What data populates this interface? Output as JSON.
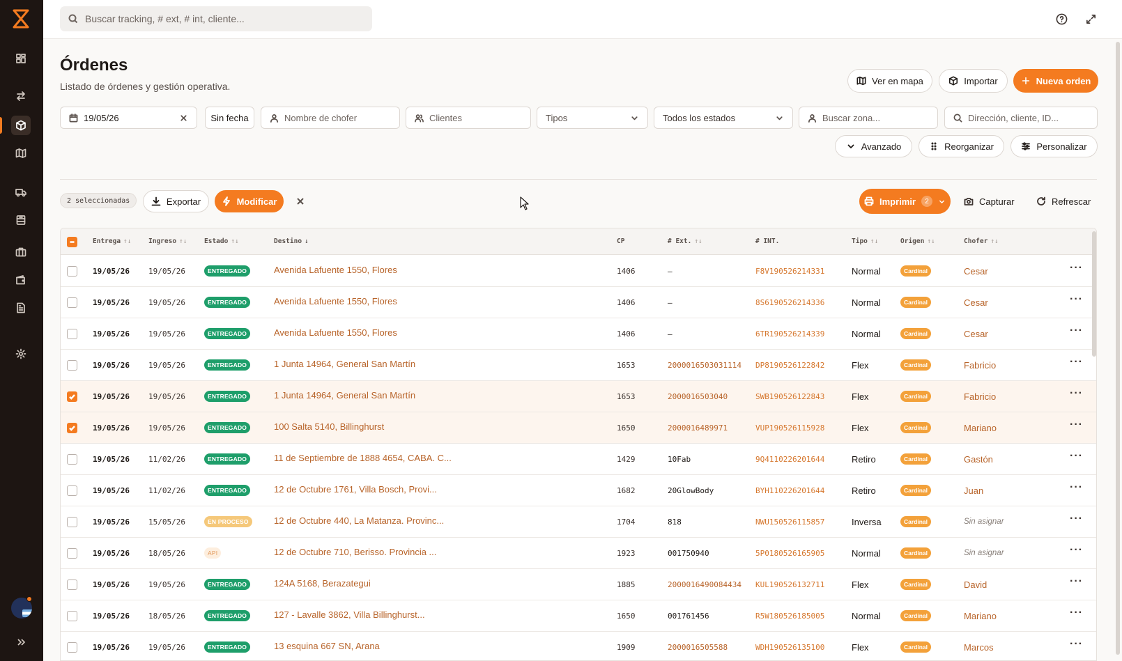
{
  "search": {
    "placeholder": "Buscar tracking, # ext, # int, cliente..."
  },
  "page": {
    "title": "Órdenes",
    "subtitle": "Listado de órdenes y gestión operativa."
  },
  "actions": {
    "map": "Ver en mapa",
    "import": "Importar",
    "new_order": "Nueva orden"
  },
  "filters": {
    "date": "19/05/26",
    "no_date": "Sin fecha",
    "driver_placeholder": "Nombre de chofer",
    "clients_placeholder": "Clientes",
    "types": "Tipos",
    "states": "Todos los estados",
    "zone_placeholder": "Buscar zona...",
    "address_placeholder": "Dirección, cliente, ID..."
  },
  "tools": {
    "advanced": "Avanzado",
    "reorganize": "Reorganizar",
    "customize": "Personalizar"
  },
  "selection": {
    "count_label": "2 seleccionadas",
    "export": "Exportar",
    "modify": "Modificar",
    "print": "Imprimir",
    "print_count": "2",
    "capture": "Capturar",
    "refresh": "Refrescar"
  },
  "table": {
    "headers": {
      "entrega": "Entrega",
      "ingreso": "Ingreso",
      "estado": "Estado",
      "destino": "Destino",
      "cp": "CP",
      "ext": "# Ext.",
      "int": "# INT.",
      "tipo": "Tipo",
      "origen": "Origen",
      "chofer": "Chofer"
    },
    "rows": [
      {
        "checked": false,
        "entrega": "19/05/26",
        "ingreso": "19/05/26",
        "estado": "ENTREGADO",
        "status_kind": "ent",
        "destino": "Avenida Lafuente 1550, Flores",
        "cp": "1406",
        "ext": "–",
        "int": "F8V190526214331",
        "tipo": "Normal",
        "origen": "Cardinal",
        "chofer": "Cesar"
      },
      {
        "checked": false,
        "entrega": "19/05/26",
        "ingreso": "19/05/26",
        "estado": "ENTREGADO",
        "status_kind": "ent",
        "destino": "Avenida Lafuente 1550, Flores",
        "cp": "1406",
        "ext": "–",
        "int": "8S6190526214336",
        "tipo": "Normal",
        "origen": "Cardinal",
        "chofer": "Cesar"
      },
      {
        "checked": false,
        "entrega": "19/05/26",
        "ingreso": "19/05/26",
        "estado": "ENTREGADO",
        "status_kind": "ent",
        "destino": "Avenida Lafuente 1550, Flores",
        "cp": "1406",
        "ext": "–",
        "int": "6TR190526214339",
        "tipo": "Normal",
        "origen": "Cardinal",
        "chofer": "Cesar"
      },
      {
        "checked": false,
        "entrega": "19/05/26",
        "ingreso": "19/05/26",
        "estado": "ENTREGADO",
        "status_kind": "ent",
        "destino": "1 Junta 14964, General San Martín",
        "cp": "1653",
        "ext": "2000016503031114",
        "int": "DP8190526122842",
        "tipo": "Flex",
        "origen": "Cardinal",
        "chofer": "Fabricio"
      },
      {
        "checked": true,
        "entrega": "19/05/26",
        "ingreso": "19/05/26",
        "estado": "ENTREGADO",
        "status_kind": "ent",
        "destino": "1 Junta 14964, General San Martín",
        "cp": "1653",
        "ext": "2000016503040",
        "int": "SWB190526122843",
        "tipo": "Flex",
        "origen": "Cardinal",
        "chofer": "Fabricio"
      },
      {
        "checked": true,
        "entrega": "19/05/26",
        "ingreso": "19/05/26",
        "estado": "ENTREGADO",
        "status_kind": "ent",
        "destino": "100 Salta 5140, Billinghurst",
        "cp": "1650",
        "ext": "2000016489971",
        "int": "VUP190526115928",
        "tipo": "Flex",
        "origen": "Cardinal",
        "chofer": "Mariano"
      },
      {
        "checked": false,
        "entrega": "19/05/26",
        "ingreso": "11/02/26",
        "estado": "ENTREGADO",
        "status_kind": "ent",
        "destino": "11 de Septiembre de 1888 4654, CABA. C...",
        "cp": "1429",
        "ext": "10Fab",
        "int": "9Q4110226201644",
        "tipo": "Retiro",
        "origen": "Cardinal",
        "chofer": "Gastón"
      },
      {
        "checked": false,
        "entrega": "19/05/26",
        "ingreso": "11/02/26",
        "estado": "ENTREGADO",
        "status_kind": "ent",
        "destino": "12 de Octubre 1761, Villa Bosch, Provi...",
        "cp": "1682",
        "ext": "20GlowBody",
        "int": "BYH110226201644",
        "tipo": "Retiro",
        "origen": "Cardinal",
        "chofer": "Juan"
      },
      {
        "checked": false,
        "entrega": "19/05/26",
        "ingreso": "15/05/26",
        "estado": "EN PROCESO",
        "status_kind": "proc",
        "destino": "12 de Octubre 440, La Matanza. Provinc...",
        "cp": "1704",
        "ext": "818",
        "int": "NWU150526115857",
        "tipo": "Inversa",
        "origen": "Cardinal",
        "chofer": "Sin asignar"
      },
      {
        "checked": false,
        "entrega": "19/05/26",
        "ingreso": "18/05/26",
        "estado": "API",
        "status_kind": "api",
        "destino": "12 de Octubre 710, Berisso. Provincia ...",
        "cp": "1923",
        "ext": "001750940",
        "int": "5P0180526165905",
        "tipo": "Normal",
        "origen": "Cardinal",
        "chofer": "Sin asignar"
      },
      {
        "checked": false,
        "entrega": "19/05/26",
        "ingreso": "19/05/26",
        "estado": "ENTREGADO",
        "status_kind": "ent",
        "destino": "124A 5168, Berazategui",
        "cp": "1885",
        "ext": "2000016490084434",
        "int": "KUL190526132711",
        "tipo": "Flex",
        "origen": "Cardinal",
        "chofer": "David"
      },
      {
        "checked": false,
        "entrega": "19/05/26",
        "ingreso": "18/05/26",
        "estado": "ENTREGADO",
        "status_kind": "ent",
        "destino": "127 - Lavalle 3862, Villa Billinghurst...",
        "cp": "1650",
        "ext": "001761456",
        "int": "R5W180526185005",
        "tipo": "Normal",
        "origen": "Cardinal",
        "chofer": "Mariano"
      },
      {
        "checked": false,
        "entrega": "19/05/26",
        "ingreso": "19/05/26",
        "estado": "ENTREGADO",
        "status_kind": "ent",
        "destino": "13 esquina 667 SN, Arana",
        "cp": "1909",
        "ext": "2000016505588",
        "int": "WDH190526135100",
        "tipo": "Flex",
        "origen": "Cardinal",
        "chofer": "Marcos"
      }
    ]
  },
  "colors": {
    "accent": "#f47b20",
    "sidebar": "#1d1512",
    "delivered": "#1e9e6a",
    "link": "#b8642a"
  }
}
